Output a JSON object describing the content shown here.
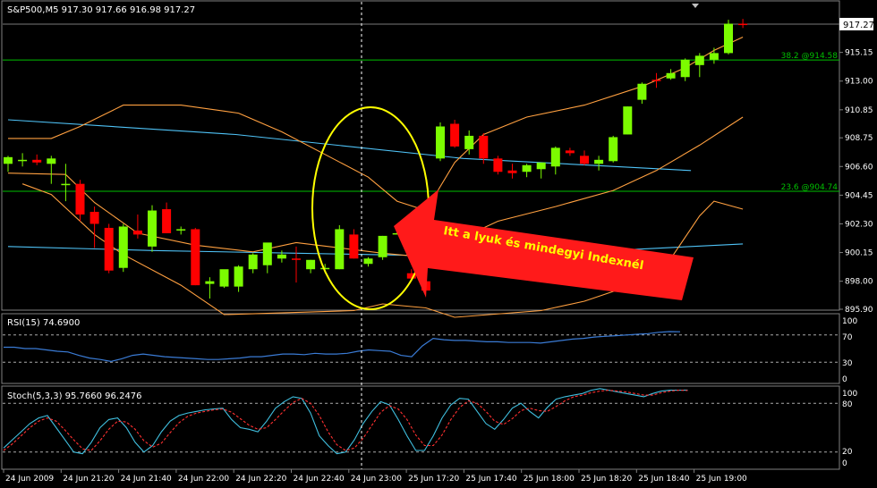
{
  "main_chart": {
    "header": "S&P500,M5  917.30 917.66 916.98 917.27",
    "price_tag": "917.27",
    "price_axis_ticks": [
      "915.15",
      "913.00",
      "910.85",
      "908.75",
      "906.60",
      "904.45",
      "902.30",
      "900.15",
      "898.00",
      "895.90"
    ],
    "price_axis_values": [
      915.15,
      913.0,
      910.85,
      908.75,
      906.6,
      904.45,
      902.3,
      900.15,
      898.0,
      895.9
    ],
    "fib_levels": [
      {
        "label": "38.2 @914.58",
        "value": 914.58
      },
      {
        "label": "23.6 @904.74",
        "value": 904.74
      }
    ],
    "annotation": "Itt a lyuk és mindegyi Indexnél",
    "colors": {
      "bull": "#7CFC00",
      "bear": "#FF0000",
      "bands": "#FFA040",
      "moving_average": "#4FC3F7",
      "fib": "#00C000",
      "ellipse": "#FFFF00",
      "arrow": "#FF1A1A"
    }
  },
  "rsi_panel": {
    "label": "RSI(15) 74.6900",
    "ticks": [
      "100",
      "70",
      "30",
      "0"
    ]
  },
  "stoch_panel": {
    "label": "Stoch(5,3,3) 95.7660 96.2476",
    "ticks": [
      "100",
      "80",
      "20",
      "0"
    ]
  },
  "time_axis": [
    "24 Jun 2009",
    "24 Jun 21:20",
    "24 Jun 21:40",
    "24 Jun 22:00",
    "24 Jun 22:20",
    "24 Jun 22:40",
    "24 Jun 23:00",
    "25 Jun 17:20",
    "25 Jun 17:40",
    "25 Jun 18:00",
    "25 Jun 18:20",
    "25 Jun 18:40",
    "25 Jun 19:00"
  ],
  "chart_data": {
    "type": "candlestick",
    "title": "S&P500,M5",
    "candles": [
      {
        "o": 906.8,
        "h": 907.4,
        "l": 906.2,
        "c": 907.3
      },
      {
        "o": 907.0,
        "h": 907.6,
        "l": 906.6,
        "c": 907.1
      },
      {
        "o": 907.1,
        "h": 907.5,
        "l": 906.7,
        "c": 906.9
      },
      {
        "o": 906.8,
        "h": 907.4,
        "l": 905.3,
        "c": 907.2
      },
      {
        "o": 905.2,
        "h": 906.8,
        "l": 904.0,
        "c": 905.3
      },
      {
        "o": 905.3,
        "h": 905.6,
        "l": 902.5,
        "c": 903.0
      },
      {
        "o": 903.2,
        "h": 903.6,
        "l": 900.5,
        "c": 902.3
      },
      {
        "o": 902.0,
        "h": 902.3,
        "l": 898.6,
        "c": 898.8
      },
      {
        "o": 899.0,
        "h": 902.3,
        "l": 898.7,
        "c": 902.1
      },
      {
        "o": 901.8,
        "h": 903.0,
        "l": 901.2,
        "c": 901.5
      },
      {
        "o": 900.6,
        "h": 903.7,
        "l": 900.2,
        "c": 903.3
      },
      {
        "o": 903.4,
        "h": 903.9,
        "l": 901.6,
        "c": 901.6
      },
      {
        "o": 901.8,
        "h": 902.1,
        "l": 901.5,
        "c": 901.9
      },
      {
        "o": 901.9,
        "h": 902.0,
        "l": 897.7,
        "c": 897.7
      },
      {
        "o": 897.8,
        "h": 898.3,
        "l": 896.7,
        "c": 898.0
      },
      {
        "o": 897.6,
        "h": 898.8,
        "l": 897.5,
        "c": 898.9
      },
      {
        "o": 897.6,
        "h": 899.2,
        "l": 897.2,
        "c": 899.1
      },
      {
        "o": 898.9,
        "h": 900.1,
        "l": 898.6,
        "c": 900.0
      },
      {
        "o": 899.2,
        "h": 900.3,
        "l": 898.6,
        "c": 900.9
      },
      {
        "o": 899.7,
        "h": 900.3,
        "l": 899.4,
        "c": 900.0
      },
      {
        "o": 899.7,
        "h": 900.6,
        "l": 897.9,
        "c": 899.6
      },
      {
        "o": 898.9,
        "h": 899.6,
        "l": 898.6,
        "c": 899.6
      },
      {
        "o": 899.0,
        "h": 899.3,
        "l": 899.0,
        "c": 899.0
      },
      {
        "o": 898.9,
        "h": 902.2,
        "l": 898.9,
        "c": 901.9
      },
      {
        "o": 901.5,
        "h": 901.9,
        "l": 899.7,
        "c": 899.7
      },
      {
        "o": 899.3,
        "h": 899.8,
        "l": 899.1,
        "c": 899.7
      },
      {
        "o": 899.8,
        "h": 901.4,
        "l": 899.6,
        "c": 901.4
      },
      {
        "o": 901.6,
        "h": 901.7,
        "l": 901.5,
        "c": 901.6
      },
      {
        "o": 898.6,
        "h": 898.9,
        "l": 898.2,
        "c": 898.2
      },
      {
        "o": 898.0,
        "h": 898.2,
        "l": 897.3,
        "c": 897.3
      },
      {
        "o": 907.2,
        "h": 909.9,
        "l": 907.0,
        "c": 909.6
      },
      {
        "o": 909.8,
        "h": 910.1,
        "l": 908.0,
        "c": 908.1
      },
      {
        "o": 907.9,
        "h": 909.3,
        "l": 907.5,
        "c": 908.9
      },
      {
        "o": 908.9,
        "h": 909.1,
        "l": 906.8,
        "c": 907.2
      },
      {
        "o": 907.2,
        "h": 907.4,
        "l": 906.0,
        "c": 906.2
      },
      {
        "o": 906.3,
        "h": 906.8,
        "l": 905.7,
        "c": 906.1
      },
      {
        "o": 906.2,
        "h": 906.8,
        "l": 905.8,
        "c": 906.7
      },
      {
        "o": 906.4,
        "h": 906.8,
        "l": 905.7,
        "c": 906.9
      },
      {
        "o": 906.6,
        "h": 908.1,
        "l": 906.0,
        "c": 908.0
      },
      {
        "o": 907.8,
        "h": 908.0,
        "l": 907.4,
        "c": 907.6
      },
      {
        "o": 907.4,
        "h": 907.8,
        "l": 906.7,
        "c": 906.8
      },
      {
        "o": 906.8,
        "h": 907.4,
        "l": 906.3,
        "c": 907.1
      },
      {
        "o": 907.0,
        "h": 908.9,
        "l": 906.9,
        "c": 908.8
      },
      {
        "o": 909.0,
        "h": 911.1,
        "l": 909.0,
        "c": 911.1
      },
      {
        "o": 911.6,
        "h": 912.9,
        "l": 911.3,
        "c": 912.8
      },
      {
        "o": 913.1,
        "h": 913.6,
        "l": 912.5,
        "c": 913.0
      },
      {
        "o": 913.2,
        "h": 913.9,
        "l": 913.1,
        "c": 913.6
      },
      {
        "o": 913.3,
        "h": 914.7,
        "l": 913.0,
        "c": 914.6
      },
      {
        "o": 914.2,
        "h": 915.1,
        "l": 913.3,
        "c": 914.9
      },
      {
        "o": 914.6,
        "h": 915.5,
        "l": 914.3,
        "c": 915.1
      },
      {
        "o": 915.1,
        "h": 917.6,
        "l": 915.0,
        "c": 917.3
      },
      {
        "o": 917.3,
        "h": 917.66,
        "l": 916.98,
        "c": 917.27
      }
    ],
    "upper_band": [
      {
        "i": 0,
        "v": 908.7
      },
      {
        "i": 3,
        "v": 908.7
      },
      {
        "i": 5,
        "v": 909.6
      },
      {
        "i": 8,
        "v": 911.2
      },
      {
        "i": 12,
        "v": 911.2
      },
      {
        "i": 16,
        "v": 910.6
      },
      {
        "i": 19,
        "v": 909.2
      },
      {
        "i": 22,
        "v": 907.5
      },
      {
        "i": 25,
        "v": 905.8
      },
      {
        "i": 27,
        "v": 904.0
      },
      {
        "i": 29,
        "v": 903.3
      },
      {
        "i": 31,
        "v": 906.9
      },
      {
        "i": 33,
        "v": 909.0
      },
      {
        "i": 36,
        "v": 910.3
      },
      {
        "i": 40,
        "v": 911.2
      },
      {
        "i": 44,
        "v": 912.6
      },
      {
        "i": 47,
        "v": 914.0
      },
      {
        "i": 49,
        "v": 915.3
      },
      {
        "i": 51,
        "v": 916.3
      }
    ],
    "middle_band": [
      {
        "i": 0,
        "v": 906.1
      },
      {
        "i": 4,
        "v": 906.0
      },
      {
        "i": 6,
        "v": 903.9
      },
      {
        "i": 9,
        "v": 901.6
      },
      {
        "i": 13,
        "v": 900.7
      },
      {
        "i": 17,
        "v": 900.2
      },
      {
        "i": 20,
        "v": 900.9
      },
      {
        "i": 23,
        "v": 900.5
      },
      {
        "i": 26,
        "v": 900.1
      },
      {
        "i": 29,
        "v": 899.8
      },
      {
        "i": 31,
        "v": 901.0
      },
      {
        "i": 34,
        "v": 902.5
      },
      {
        "i": 38,
        "v": 903.6
      },
      {
        "i": 42,
        "v": 904.8
      },
      {
        "i": 45,
        "v": 906.3
      },
      {
        "i": 48,
        "v": 908.2
      },
      {
        "i": 51,
        "v": 910.3
      }
    ],
    "lower_band": [
      {
        "i": 1,
        "v": 905.3
      },
      {
        "i": 3,
        "v": 904.5
      },
      {
        "i": 6,
        "v": 901.5
      },
      {
        "i": 8,
        "v": 900.0
      },
      {
        "i": 12,
        "v": 897.7
      },
      {
        "i": 15,
        "v": 895.5
      },
      {
        "i": 24,
        "v": 895.8
      },
      {
        "i": 26,
        "v": 896.3
      },
      {
        "i": 29,
        "v": 896.0
      },
      {
        "i": 31,
        "v": 895.3
      },
      {
        "i": 37,
        "v": 895.8
      },
      {
        "i": 40,
        "v": 896.5
      },
      {
        "i": 43,
        "v": 897.6
      },
      {
        "i": 45,
        "v": 898.8
      },
      {
        "i": 46,
        "v": 899.7
      },
      {
        "i": 48,
        "v": 902.9
      },
      {
        "i": 49,
        "v": 904.0
      },
      {
        "i": 51,
        "v": 903.4
      }
    ],
    "slow_ma": [
      {
        "i": 0,
        "v": 910.1
      },
      {
        "i": 20,
        "v": 909.0
      },
      {
        "i": 40,
        "v": 907.2
      },
      {
        "i": 60,
        "v": 906.3
      }
    ],
    "fast_ma": [
      {
        "i": 0,
        "v": 900.6
      },
      {
        "i": 10,
        "v": 900.3
      },
      {
        "i": 20,
        "v": 900.1
      },
      {
        "i": 30,
        "v": 899.9
      },
      {
        "i": 40,
        "v": 900.2
      },
      {
        "i": 51,
        "v": 900.8
      }
    ],
    "rsi": {
      "ylim": [
        0,
        100
      ],
      "levels": [
        70,
        30
      ],
      "values": [
        52,
        52,
        50,
        50,
        48,
        46,
        45,
        40,
        36,
        34,
        31,
        35,
        40,
        42,
        40,
        38,
        37,
        36,
        35,
        34,
        34,
        35,
        36,
        38,
        38,
        40,
        42,
        42,
        41,
        43,
        42,
        42,
        43,
        46,
        48,
        47,
        46,
        40,
        38,
        54,
        65,
        63,
        62,
        62,
        61,
        60,
        60,
        59,
        59,
        59,
        58,
        60,
        62,
        64,
        65,
        67,
        68,
        69,
        70,
        71,
        72,
        74,
        75,
        74.69
      ]
    },
    "stoch": {
      "ylim": [
        0,
        100
      ],
      "levels": [
        80,
        20
      ],
      "k": [
        25,
        35,
        45,
        55,
        62,
        65,
        50,
        35,
        20,
        18,
        32,
        50,
        60,
        62,
        50,
        32,
        20,
        28,
        45,
        58,
        65,
        68,
        70,
        72,
        73,
        74,
        60,
        50,
        48,
        45,
        58,
        74,
        82,
        88,
        86,
        68,
        40,
        28,
        18,
        20,
        35,
        55,
        70,
        82,
        78,
        60,
        40,
        22,
        22,
        40,
        62,
        78,
        86,
        85,
        70,
        55,
        48,
        60,
        74,
        80,
        70,
        62,
        75,
        85,
        88,
        90,
        92,
        96,
        98,
        96,
        94,
        92,
        90,
        88,
        92,
        95,
        96,
        96,
        96.2476
      ],
      "d": [
        22,
        30,
        40,
        50,
        58,
        62,
        58,
        47,
        35,
        24,
        22,
        34,
        48,
        58,
        57,
        48,
        34,
        26,
        31,
        44,
        56,
        64,
        68,
        70,
        72,
        73,
        69,
        61,
        53,
        48,
        50,
        60,
        71,
        81,
        86,
        80,
        65,
        45,
        29,
        22,
        25,
        37,
        53,
        69,
        77,
        73,
        60,
        41,
        28,
        28,
        41,
        60,
        75,
        83,
        80,
        70,
        58,
        54,
        61,
        71,
        74,
        71,
        70,
        76,
        83,
        88,
        90,
        93,
        95,
        96,
        95,
        94,
        92,
        90,
        90,
        93,
        95,
        96,
        95.766
      ]
    }
  }
}
